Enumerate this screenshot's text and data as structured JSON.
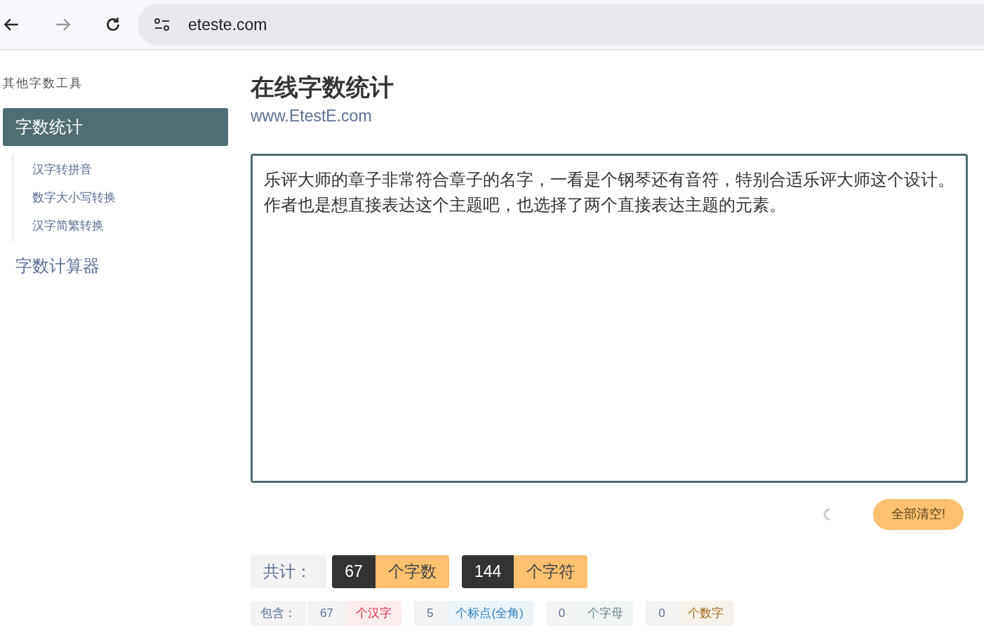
{
  "browser": {
    "url": "eteste.com"
  },
  "sidebar": {
    "heading": "其他字数工具",
    "items": [
      {
        "label": "字数统计",
        "selected": true,
        "children": [
          {
            "label": "汉字转拼音"
          },
          {
            "label": "数字大小写转换"
          },
          {
            "label": "汉字简繁转换"
          }
        ]
      },
      {
        "label": "字数计算器",
        "selected": false
      }
    ]
  },
  "page": {
    "title": "在线字数统计",
    "subtitle": "www.EtestE.com"
  },
  "editor": {
    "value": "乐评大师的章子非常符合章子的名字，一看是个钢琴还有音符，特别合适乐评大师这个设计。作者也是想直接表达这个主题吧，也选择了两个直接表达主题的元素。"
  },
  "clear_button": "全部清空!",
  "totals": {
    "label": "共计：",
    "items": [
      {
        "value": "67",
        "unit": "个字数"
      },
      {
        "value": "144",
        "unit": "个字符"
      }
    ]
  },
  "breakdown": {
    "label": "包含：",
    "items": [
      {
        "value": "67",
        "unit": "个汉字",
        "color": "#e0314b"
      },
      {
        "value": "5",
        "unit": "个标点(全角)",
        "color": "#2f7fc1"
      },
      {
        "value": "0",
        "unit": "个字母",
        "color": "#6b8a8a"
      },
      {
        "value": "0",
        "unit": "个数字",
        "color": "#a06a1c"
      }
    ]
  }
}
